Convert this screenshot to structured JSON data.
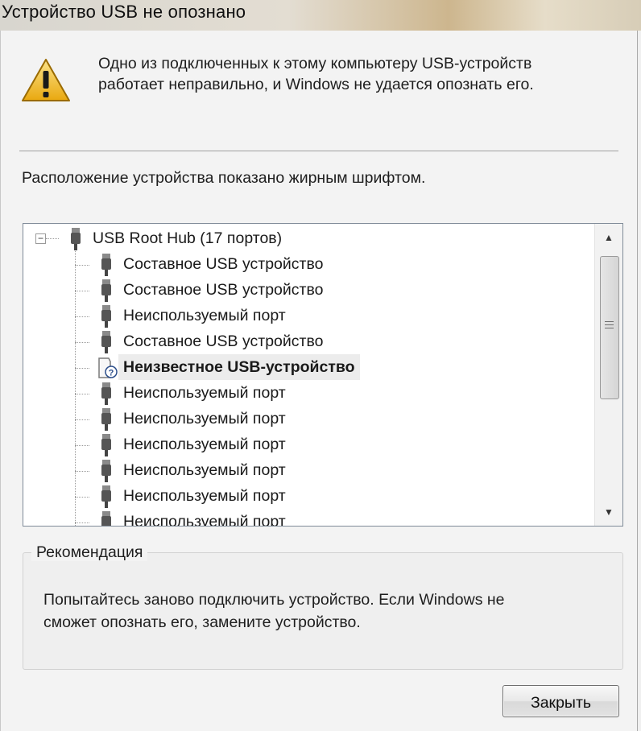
{
  "window": {
    "title": "Устройство USB не опознано"
  },
  "message": {
    "line1": "Одно из подключенных к этому компьютеру USB-устройств",
    "line2": "работает неправильно, и Windows не удается опознать его.",
    "icon": "warning-icon"
  },
  "hint": "Расположение устройства показано жирным шрифтом.",
  "tree": {
    "expander": "−",
    "root": {
      "label": "USB Root Hub (17 портов)",
      "icon": "usb-plug-icon"
    },
    "items": [
      {
        "label": "Составное USB устройство",
        "icon": "usb-plug-icon",
        "bold": false
      },
      {
        "label": "Составное USB устройство",
        "icon": "usb-plug-icon",
        "bold": false
      },
      {
        "label": "Неиспользуемый порт",
        "icon": "usb-plug-icon",
        "bold": false
      },
      {
        "label": "Составное USB устройство",
        "icon": "usb-plug-icon",
        "bold": false
      },
      {
        "label": "Неизвестное USB-устройство",
        "icon": "unknown-device-icon",
        "bold": true
      },
      {
        "label": "Неиспользуемый порт",
        "icon": "usb-plug-icon",
        "bold": false
      },
      {
        "label": "Неиспользуемый порт",
        "icon": "usb-plug-icon",
        "bold": false
      },
      {
        "label": "Неиспользуемый порт",
        "icon": "usb-plug-icon",
        "bold": false
      },
      {
        "label": "Неиспользуемый порт",
        "icon": "usb-plug-icon",
        "bold": false
      },
      {
        "label": "Неиспользуемый порт",
        "icon": "usb-plug-icon",
        "bold": false
      },
      {
        "label": "Неиспользуемый порт",
        "icon": "usb-plug-icon",
        "bold": false
      }
    ],
    "scroll_up": "▲",
    "scroll_down": "▼"
  },
  "recommendation": {
    "legend": "Рекомендация",
    "line1": "Попытайтесь заново подключить устройство. Если Windows не",
    "line2": "сможет опознать его, замените устройство."
  },
  "buttons": {
    "close_label": "Закрыть"
  },
  "colors": {
    "selected_bg": "#ececec",
    "warning_fill": "#f2c21b"
  }
}
